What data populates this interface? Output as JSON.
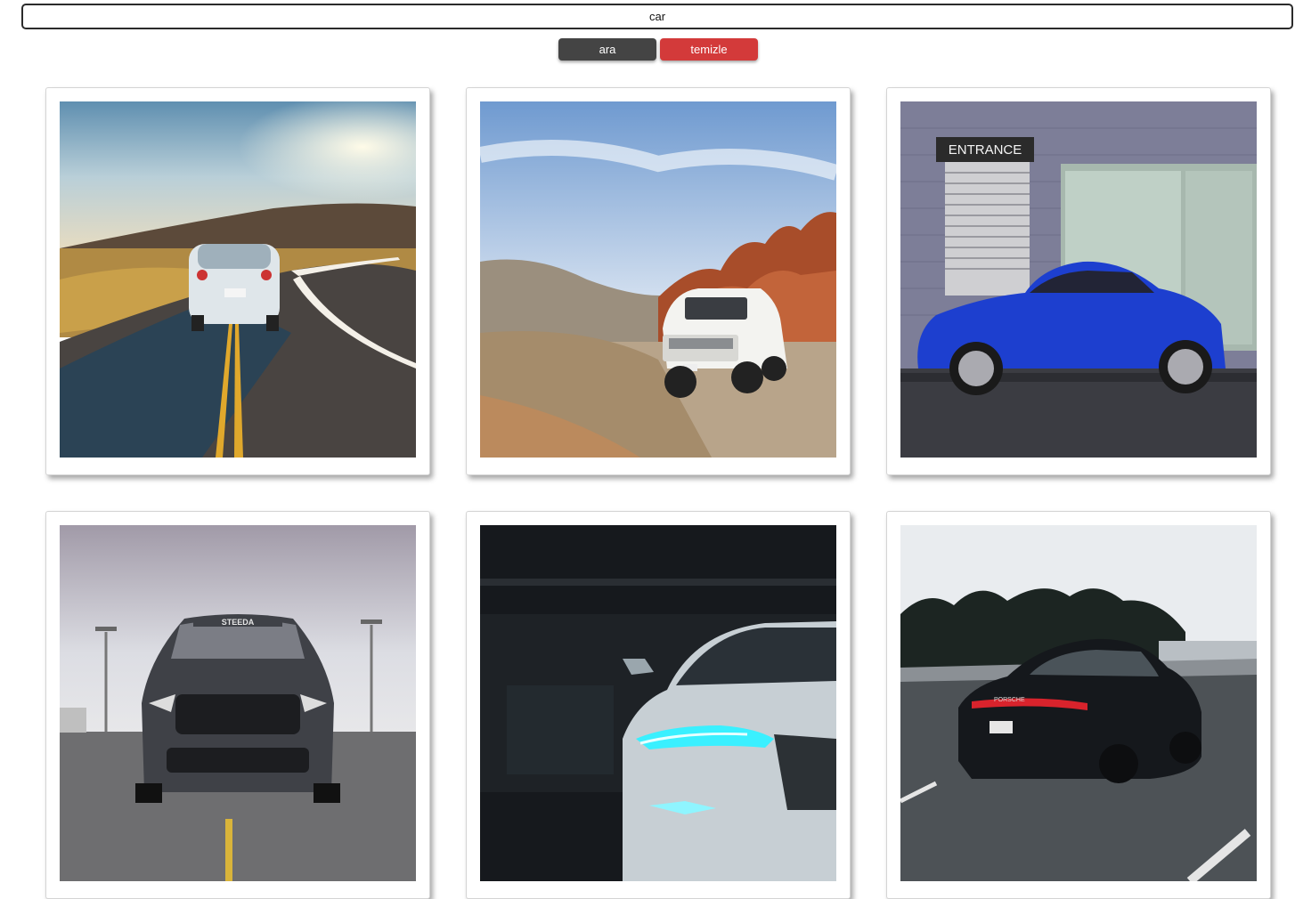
{
  "search": {
    "value": "car"
  },
  "buttons": {
    "search_label": "ara",
    "clear_label": "temizle"
  },
  "results": [
    {
      "subject": "white sports car on mountain road at sunset"
    },
    {
      "subject": "white SUV on desert road with red rocks"
    },
    {
      "subject": "blue coupe parked by entrance",
      "sign_text": "ENTRANCE"
    },
    {
      "subject": "grey muscle car front view on tarmac",
      "windshield_text": "STEEDA"
    },
    {
      "subject": "silver sedan headlights in dark garage"
    },
    {
      "subject": "black sedan on highway",
      "badge_text": "PORSCHE"
    }
  ],
  "colors": {
    "search_button": "#444444",
    "clear_button": "#d33a3a"
  }
}
